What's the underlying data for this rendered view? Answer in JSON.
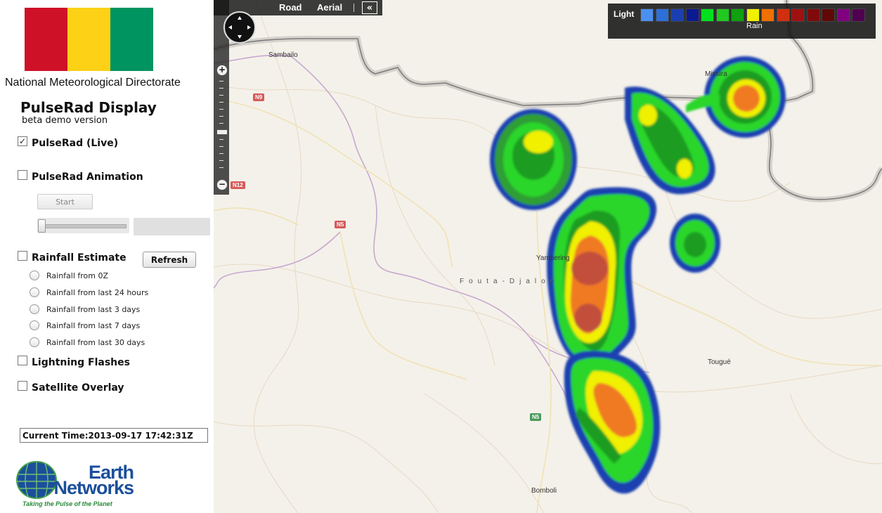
{
  "sidebar": {
    "flag_colors": [
      "#ce1126",
      "#fcd116",
      "#009460"
    ],
    "organization": "National Meteorological Directorate",
    "app_title": "PulseRad Display",
    "app_subtitle": "beta demo version",
    "options": {
      "live": {
        "label": "PulseRad (Live)",
        "checked": true
      },
      "animation": {
        "label": "PulseRad Animation",
        "checked": false
      },
      "rainfall": {
        "label": "Rainfall Estimate",
        "checked": false
      },
      "lightning": {
        "label": "Lightning Flashes",
        "checked": false
      },
      "satellite": {
        "label": "Satellite Overlay",
        "checked": false
      }
    },
    "start_button": "Start",
    "animation_slider_value": 0,
    "refresh_button": "Refresh",
    "rainfall_periods": [
      "Rainfall from 0Z",
      "Rainfall from last 24 hours",
      "Rainfall from last 3 days",
      "Rainfall from last 7 days",
      "Rainfall from last 30 days"
    ],
    "current_time": "Current Time:2013-09-17 17:42:31Z",
    "logo": {
      "line1": "Earth",
      "line2": "Networks",
      "tagline": "Taking the Pulse of the Planet"
    }
  },
  "map": {
    "map_types": {
      "road": "Road",
      "aerial": "Aerial",
      "collapse": "«"
    },
    "zoom_in": "+",
    "zoom_out": "−",
    "places": [
      "Sambailo",
      "Missira",
      "Yambering",
      "Tougué",
      "Bomboli"
    ],
    "region": "Fouta-Djalon",
    "roads": [
      "N9",
      "N12",
      "N5",
      "N5"
    ],
    "legend": {
      "label": "Light",
      "category": "Rain",
      "colors": [
        "#4a90f0",
        "#2d6fd8",
        "#1a3fb0",
        "#0a1a90",
        "#00e020",
        "#20c820",
        "#10a010",
        "#f0f000",
        "#f07000",
        "#d03010",
        "#a01010",
        "#800a0a",
        "#600808",
        "#800080",
        "#500050"
      ]
    }
  }
}
